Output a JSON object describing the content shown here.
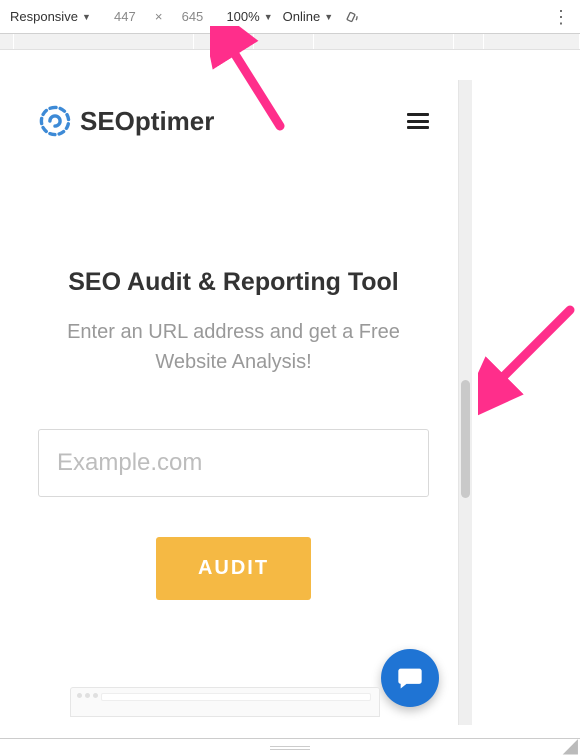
{
  "toolbar": {
    "device_dropdown": "Responsive",
    "width": "447",
    "height": "645",
    "zoom": "100%",
    "throttle": "Online"
  },
  "brand": {
    "name": "SEOptimer"
  },
  "hero": {
    "title": "SEO Audit & Reporting Tool",
    "subtitle": "Enter an URL address and get a Free Website Analysis!"
  },
  "form": {
    "url_placeholder": "Example.com",
    "audit_label": "AUDIT"
  }
}
